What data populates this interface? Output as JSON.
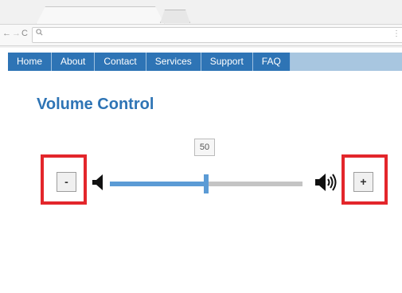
{
  "browser": {
    "back_icon": "←",
    "forward_icon": "→",
    "reload_icon": "C",
    "address_icon": "search-icon",
    "address_text": "",
    "menu_icon": "⋮"
  },
  "nav": {
    "items": [
      {
        "label": "Home"
      },
      {
        "label": "About"
      },
      {
        "label": "Contact"
      },
      {
        "label": "Services"
      },
      {
        "label": "Support"
      },
      {
        "label": "FAQ"
      }
    ]
  },
  "page": {
    "title": "Volume Control"
  },
  "volume": {
    "value_label": "50",
    "level_fraction": 0.5,
    "decrease_label": "-",
    "increase_label": "+"
  },
  "colors": {
    "accent": "#2e74b5",
    "track_fill": "#5b9bd5",
    "highlight": "#e3262b"
  }
}
